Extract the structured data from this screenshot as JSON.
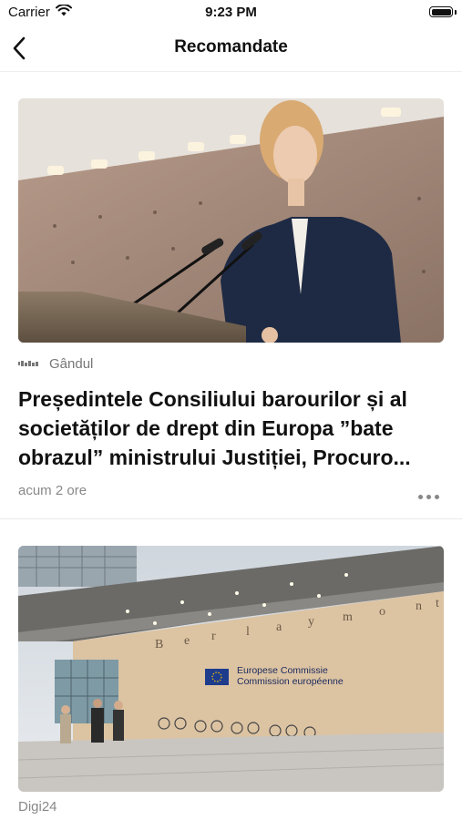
{
  "status": {
    "carrier": "Carrier",
    "time": "9:23 PM"
  },
  "nav": {
    "title": "Recomandate"
  },
  "articles": [
    {
      "source": "Gândul",
      "headline": "Președintele Consiliului barourilor și al societăților de drept din Europa ”bate obrazul” ministrului Justiției, Procuro...",
      "time_ago": "acum 2 ore"
    },
    {
      "source": "Digi24",
      "image_texts": {
        "building_sign": "Berlaymont",
        "plaque_line1": "Europese Commissie",
        "plaque_line2": "Commission européenne"
      }
    }
  ],
  "icons": {
    "wifi": "wifi-icon",
    "battery": "battery-icon",
    "back": "chevron-left-icon",
    "more": "ellipsis-icon"
  },
  "colors": {
    "text": "#111111",
    "secondary": "#888888",
    "divider": "#e8e8e8"
  }
}
